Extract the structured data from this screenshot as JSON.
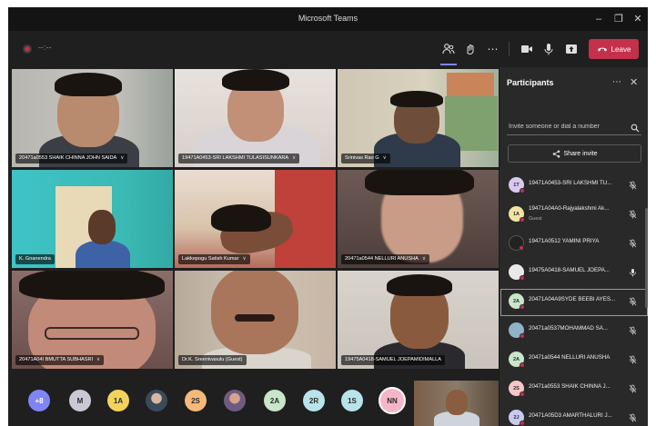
{
  "window": {
    "title": "Microsoft Teams",
    "minimize_icon": "minimize-icon",
    "maximize_icon": "maximize-icon",
    "close_icon": "close-icon"
  },
  "toolbar": {
    "meeting_time": "--:--",
    "leave_label": "Leave",
    "leave_color": "#c4314b",
    "accent_color": "#7f85f5"
  },
  "video_tiles": [
    {
      "name": "20471a0553 SHAIK CHINNA JOHN SAIDA"
    },
    {
      "name": "19471A0453-SRI LAKSHMI TULASISUNKARA"
    },
    {
      "name": "Srinivas Rao G"
    },
    {
      "name": "K. Gnanendra"
    },
    {
      "name": "Lakkepogu Satish Kumar"
    },
    {
      "name": "20471a0544 NELLURI ANUSHA"
    },
    {
      "name": "20471A04I BMUTTA SUBHASRI"
    },
    {
      "name": "Dr.K. Sreenivasulu (Guest)"
    },
    {
      "name": "19475A0418-SAMUEL JOEPAMIDIMALLA"
    }
  ],
  "bottom_strip": {
    "avatars": [
      {
        "initials": "+8",
        "color": "#7f85f5"
      },
      {
        "initials": "M",
        "color": "#c9c9d6"
      },
      {
        "initials": "1A",
        "color": "#f3d35b"
      },
      {
        "initials": "",
        "color": "#6d7a8a"
      },
      {
        "initials": "2S",
        "color": "#f5b97a"
      },
      {
        "initials": "",
        "color": "#8a7a8f"
      },
      {
        "initials": "2A",
        "color": "#c8e6c9"
      },
      {
        "initials": "2R",
        "color": "#b9e3ea"
      },
      {
        "initials": "1S",
        "color": "#b9e3ea"
      },
      {
        "initials": "NN",
        "color": "#f7b6c8"
      }
    ]
  },
  "participants_panel": {
    "title": "Participants",
    "search_placeholder": "Invite someone or dial a number",
    "share_invite_label": "Share invite",
    "list": [
      {
        "initials": "1T",
        "color": "#d9c8f0",
        "name": "19471A0453-SRI LAKSHMI TU...",
        "subtitle": "",
        "mic": "mic-off"
      },
      {
        "initials": "1A",
        "color": "#f3e3a1",
        "name": "19471A04A0-Rajyalakshmi Ak...",
        "subtitle": "Guest",
        "mic": "mic-off"
      },
      {
        "initials": "",
        "color": "#222222",
        "name": "19471A0512 YAMINI PRIYA",
        "subtitle": "",
        "mic": "mic-off"
      },
      {
        "initials": "",
        "color": "#e9e9e9",
        "name": "19475A0418-SAMUEL JOEPA...",
        "subtitle": "",
        "mic": "mic-on"
      },
      {
        "initials": "2A",
        "color": "#c8e6c9",
        "name": "20471A04A9SYDE BEEBI AYES...",
        "subtitle": "",
        "mic": "mic-off"
      },
      {
        "initials": "",
        "color": "#8fb3c9",
        "name": "20471a0537MOHAMMAD SA...",
        "subtitle": "",
        "mic": "mic-off"
      },
      {
        "initials": "2A",
        "color": "#c8e6c9",
        "name": "20471a0544 NELLURI ANUSHA",
        "subtitle": "",
        "mic": "mic-off"
      },
      {
        "initials": "2S",
        "color": "#f7c6c6",
        "name": "20471a0553 SHAIK CHINNA J...",
        "subtitle": "",
        "mic": "mic-off"
      },
      {
        "initials": "2J",
        "color": "#c9c9f0",
        "name": "20471A05D3 AMARTHALURI J...",
        "subtitle": "",
        "mic": "mic-off"
      }
    ]
  }
}
